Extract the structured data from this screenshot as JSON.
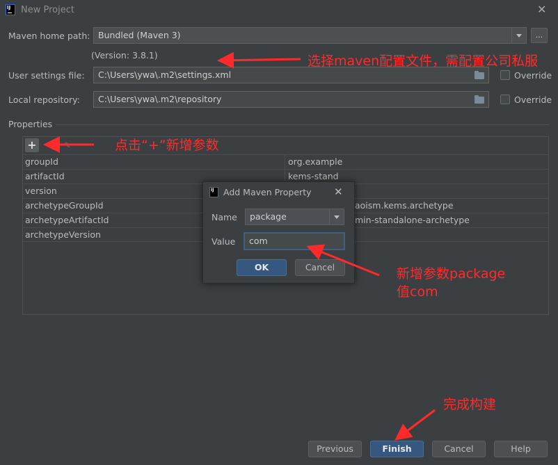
{
  "window": {
    "title": "New Project"
  },
  "form": {
    "maven_home_label": "Maven home path:",
    "maven_home_value": "Bundled (Maven 3)",
    "browse_label": "...",
    "version_text": "(Version: 3.8.1)",
    "user_settings_label": "User settings file:",
    "user_settings_value": "C:\\Users\\ywa\\.m2\\settings.xml",
    "local_repo_label": "Local repository:",
    "local_repo_value": "C:\\Users\\ywa\\.m2\\repository",
    "override_label": "Override"
  },
  "properties": {
    "section_title": "Properties",
    "add_label": "+",
    "rows": [
      {
        "key": "groupId",
        "value": "org.example"
      },
      {
        "key": "artifactId",
        "value": "kems-stand"
      },
      {
        "key": "version",
        "value": ""
      },
      {
        "key": "archetypeGroupId",
        "value": "aoism.kems.archetype"
      },
      {
        "key": "archetypeArtifactId",
        "value": "min-standalone-archetype"
      },
      {
        "key": "archetypeVersion",
        "value": ""
      }
    ]
  },
  "dialog": {
    "title": "Add Maven Property",
    "name_label": "Name",
    "name_value": "package",
    "value_label": "Value",
    "value_value": "com",
    "ok_label": "OK",
    "cancel_label": "Cancel"
  },
  "footer": {
    "previous_label": "Previous",
    "finish_label": "Finish",
    "cancel_label": "Cancel",
    "help_label": "Help"
  },
  "annotations": {
    "settings_note": "选择maven配置文件，需配置公司私服",
    "add_note": "点击“+”新增参数",
    "param_note_line1": "新增参数package",
    "param_note_line2": "值com",
    "finish_note": "完成构建",
    "color": "#ff2b2b"
  }
}
